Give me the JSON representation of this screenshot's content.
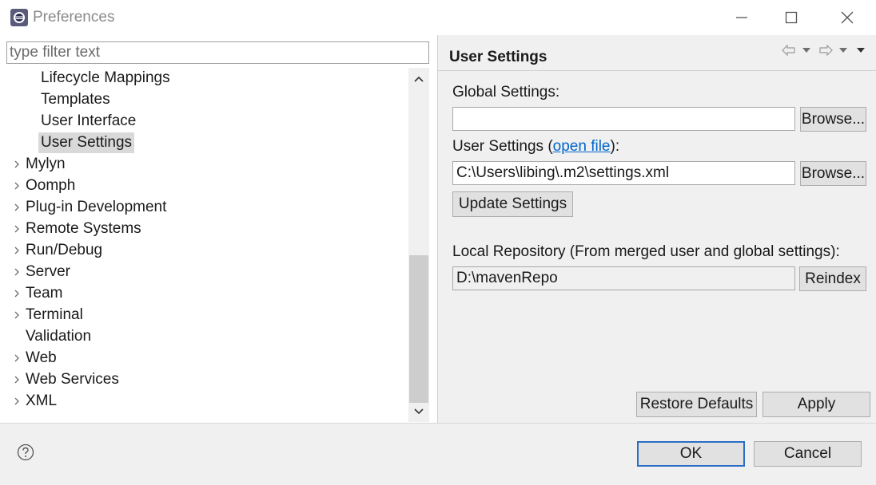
{
  "window": {
    "title": "Preferences"
  },
  "filter": {
    "placeholder": "type filter text"
  },
  "tree": {
    "items": [
      {
        "label": "Lifecycle Mappings",
        "expandable": false,
        "indent": 2
      },
      {
        "label": "Templates",
        "expandable": false,
        "indent": 2
      },
      {
        "label": "User Interface",
        "expandable": false,
        "indent": 2
      },
      {
        "label": "User Settings",
        "expandable": false,
        "indent": 2,
        "selected": true
      },
      {
        "label": "Mylyn",
        "expandable": true,
        "indent": 1
      },
      {
        "label": "Oomph",
        "expandable": true,
        "indent": 1
      },
      {
        "label": "Plug-in Development",
        "expandable": true,
        "indent": 1
      },
      {
        "label": "Remote Systems",
        "expandable": true,
        "indent": 1
      },
      {
        "label": "Run/Debug",
        "expandable": true,
        "indent": 1
      },
      {
        "label": "Server",
        "expandable": true,
        "indent": 1
      },
      {
        "label": "Team",
        "expandable": true,
        "indent": 1
      },
      {
        "label": "Terminal",
        "expandable": true,
        "indent": 1
      },
      {
        "label": "Validation",
        "expandable": false,
        "indent": 1
      },
      {
        "label": "Web",
        "expandable": true,
        "indent": 1
      },
      {
        "label": "Web Services",
        "expandable": true,
        "indent": 1
      },
      {
        "label": "XML",
        "expandable": true,
        "indent": 1
      }
    ]
  },
  "page": {
    "title": "User Settings",
    "global_settings_label": "Global Settings:",
    "global_settings_value": "",
    "browse_label": "Browse...",
    "user_settings_label_prefix": "User Settings (",
    "user_settings_link": "open file",
    "user_settings_label_suffix": "):",
    "user_settings_value": "C:\\Users\\libing\\.m2\\settings.xml",
    "update_settings_label": "Update Settings",
    "local_repo_label": "Local Repository (From merged user and global settings):",
    "local_repo_value": "D:\\mavenRepo",
    "reindex_label": "Reindex",
    "restore_defaults_label": "Restore Defaults",
    "apply_label": "Apply"
  },
  "footer": {
    "ok_label": "OK",
    "cancel_label": "Cancel"
  },
  "colors": {
    "accent": "#2b6dc7",
    "link": "#0066cc",
    "selection": "#d9d9d9",
    "panel": "#f0f0f0"
  }
}
